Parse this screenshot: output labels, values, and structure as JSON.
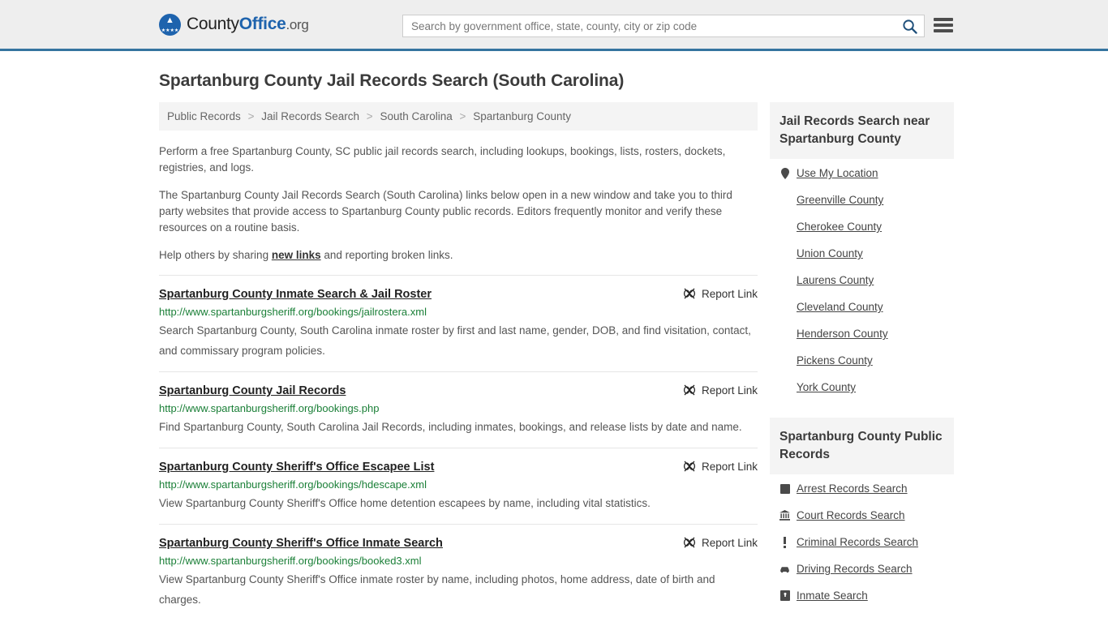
{
  "header": {
    "logo": {
      "county": "County",
      "office": "Office",
      "org": ".org",
      "emblem_icon": "eagle-seal-icon"
    },
    "search": {
      "placeholder": "Search by government office, state, county, city or zip code",
      "value": "",
      "search_icon": "search-icon"
    },
    "menu_icon": "hamburger-menu-icon",
    "accent_color": "#35749f"
  },
  "main": {
    "title": "Spartanburg County Jail Records Search (South Carolina)",
    "breadcrumb": [
      "Public Records",
      "Jail Records Search",
      "South Carolina",
      "Spartanburg County"
    ],
    "breadcrumb_separator": ">",
    "intro": {
      "p1": "Perform a free Spartanburg County, SC public jail records search, including lookups, bookings, lists, rosters, dockets, registries, and logs.",
      "p2": "The Spartanburg County Jail Records Search (South Carolina) links below open in a new window and take you to third party websites that provide access to Spartanburg County public records. Editors frequently monitor and verify these resources on a routine basis.",
      "p3_before": "Help others by sharing ",
      "p3_link": "new links",
      "p3_after": " and reporting broken links."
    },
    "report_link_label": "Report Link",
    "report_link_icon": "broken-link-icon",
    "results": [
      {
        "title": "Spartanburg County Inmate Search & Jail Roster",
        "url": "http://www.spartanburgsheriff.org/bookings/jailrostera.xml",
        "description": "Search Spartanburg County, South Carolina inmate roster by first and last name, gender, DOB, and find visitation, contact, and commissary program policies."
      },
      {
        "title": "Spartanburg County Jail Records",
        "url": "http://www.spartanburgsheriff.org/bookings.php",
        "description": "Find Spartanburg County, South Carolina Jail Records, including inmates, bookings, and release lists by date and name."
      },
      {
        "title": "Spartanburg County Sheriff's Office Escapee List",
        "url": "http://www.spartanburgsheriff.org/bookings/hdescape.xml",
        "description": "View Spartanburg County Sheriff's Office home detention escapees by name, including vital statistics."
      },
      {
        "title": "Spartanburg County Sheriff's Office Inmate Search",
        "url": "http://www.spartanburgsheriff.org/bookings/booked3.xml",
        "description": "View Spartanburg County Sheriff's Office inmate roster by name, including photos, home address, date of birth and charges."
      }
    ]
  },
  "sidebar": {
    "nearby": {
      "title": "Jail Records Search near Spartanburg County",
      "items": [
        {
          "label": "Use My Location",
          "icon": "map-pin-icon"
        },
        {
          "label": "Greenville County",
          "icon": ""
        },
        {
          "label": "Cherokee County",
          "icon": ""
        },
        {
          "label": "Union County",
          "icon": ""
        },
        {
          "label": "Laurens County",
          "icon": ""
        },
        {
          "label": "Cleveland County",
          "icon": ""
        },
        {
          "label": "Henderson County",
          "icon": ""
        },
        {
          "label": "Pickens County",
          "icon": ""
        },
        {
          "label": "York County",
          "icon": ""
        }
      ]
    },
    "public_records": {
      "title": "Spartanburg County Public Records",
      "items": [
        {
          "label": "Arrest Records Search",
          "icon": "fingerprint-icon"
        },
        {
          "label": "Court Records Search",
          "icon": "courthouse-icon"
        },
        {
          "label": "Criminal Records Search",
          "icon": "exclamation-icon"
        },
        {
          "label": "Driving Records Search",
          "icon": "car-icon"
        },
        {
          "label": "Inmate Search",
          "icon": "jail-icon"
        }
      ]
    }
  }
}
